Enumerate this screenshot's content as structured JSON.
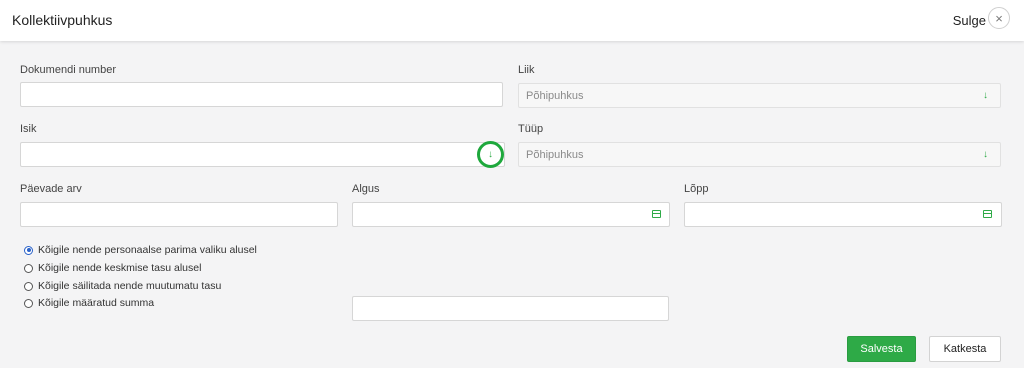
{
  "header": {
    "title": "Kollektiivpuhkus",
    "close_label": "Sulge",
    "close_icon": "×"
  },
  "form": {
    "document_number": {
      "label": "Dokumendi number",
      "value": ""
    },
    "kind": {
      "label": "Liik",
      "value": "Põhipuhkus"
    },
    "person": {
      "label": "Isik",
      "value": ""
    },
    "type": {
      "label": "Tüüp",
      "value": "Põhipuhkus"
    },
    "days": {
      "label": "Päevade arv",
      "value": ""
    },
    "start": {
      "label": "Algus",
      "value": ""
    },
    "end": {
      "label": "Lõpp",
      "value": ""
    },
    "amount": {
      "value": ""
    }
  },
  "options": [
    {
      "label": "Kõigile nende personaalse parima valiku alusel",
      "checked": true
    },
    {
      "label": "Kõigile nende keskmise tasu alusel",
      "checked": false
    },
    {
      "label": "Kõigile säilitada nende muutumatu tasu",
      "checked": false
    },
    {
      "label": "Kõigile määratud summa",
      "checked": false
    }
  ],
  "buttons": {
    "save": "Salvesta",
    "cancel": "Katkesta"
  },
  "icons": {
    "dropdown": "↓"
  },
  "colors": {
    "accent": "#2eaa47",
    "radio": "#2a62c9"
  }
}
